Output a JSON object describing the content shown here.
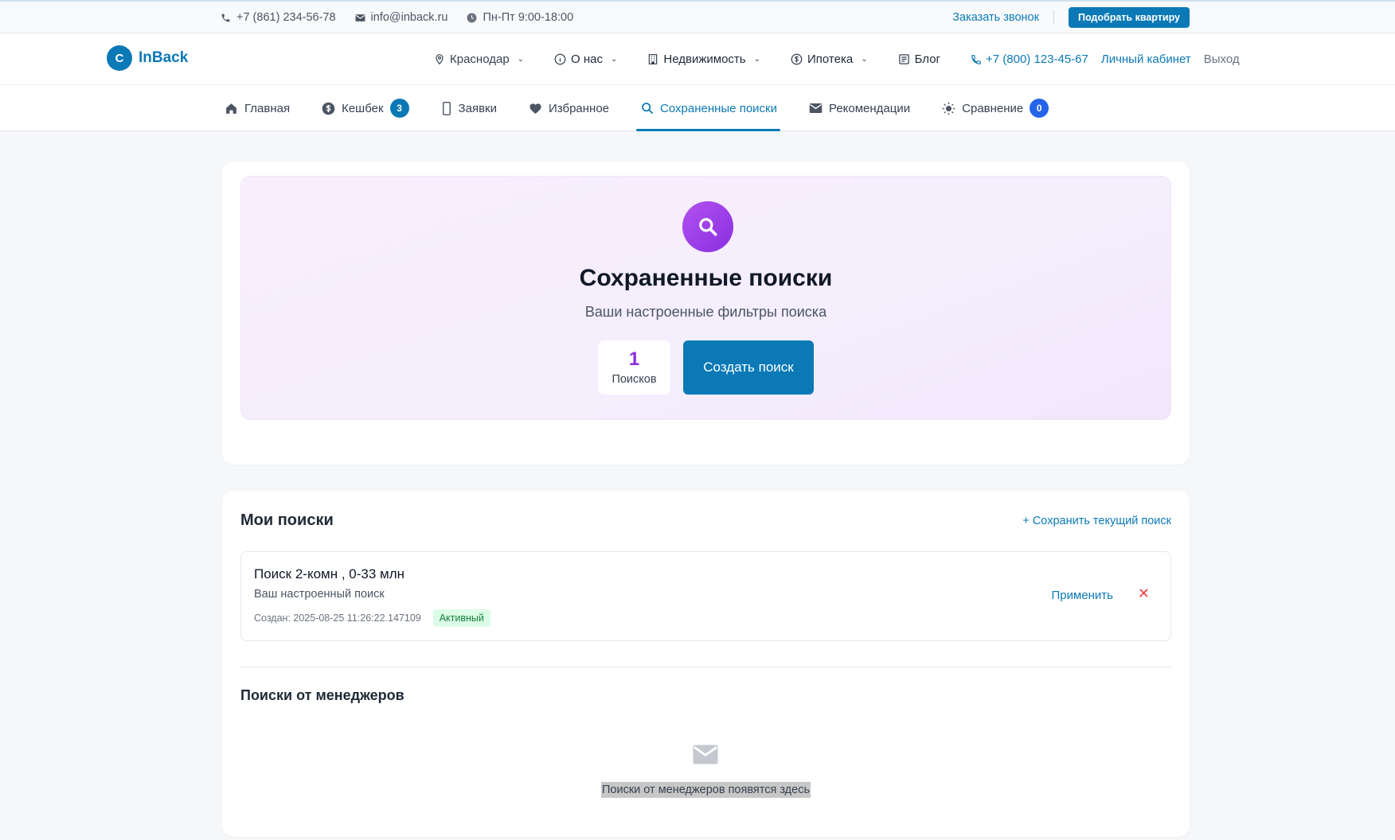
{
  "topbar": {
    "phone": "+7 (861) 234-56-78",
    "email": "info@inback.ru",
    "hours": "Пн-Пт 9:00-18:00",
    "callback": "Заказать звонок",
    "pick_apartment": "Подобрать квартиру"
  },
  "header": {
    "logo_letter": "C",
    "logo_name": "InBack",
    "city": "Краснодар",
    "nav": {
      "about": "О нас",
      "realty": "Недвижимость",
      "mortgage": "Ипотека",
      "blog": "Блог"
    },
    "phone": "+7 (800) 123-45-67",
    "cabinet": "Личный кабинет",
    "logout": "Выход"
  },
  "subnav": {
    "home": "Главная",
    "cashback": "Кешбек",
    "cashback_count": "3",
    "requests": "Заявки",
    "favorites": "Избранное",
    "saved_searches": "Сохраненные поиски",
    "recommendations": "Рекомендации",
    "comparison": "Сравнение",
    "comparison_count": "0"
  },
  "hero": {
    "title": "Сохраненные поиски",
    "subtitle": "Ваши настроенные фильтры поиска",
    "count": "1",
    "count_label": "Поисков",
    "create_button": "Создать поиск"
  },
  "my_searches": {
    "title": "Мои поиски",
    "save_current": "+ Сохранить текущий поиск",
    "items": [
      {
        "title": "Поиск 2-комн , 0-33 млн",
        "description": "Ваш настроенный поиск",
        "created": "Создан: 2025-08-25 11:26:22.147109",
        "status": "Активный",
        "apply": "Применить",
        "delete": "✕"
      }
    ]
  },
  "manager_searches": {
    "title": "Поиски от менеджеров",
    "empty": "Поиски от менеджеров появятся здесь"
  },
  "colors": {
    "brand": "#0b79b6",
    "accent_purple": "#8a2fe0",
    "badge_blue": "#2563eb",
    "status_green": "#15803d"
  },
  "icons": [
    "phone-icon",
    "mail-icon",
    "clock-icon",
    "pin-icon",
    "info-icon",
    "building-icon",
    "dollar-icon",
    "news-icon",
    "home-icon",
    "coin-icon",
    "phone-device-icon",
    "heart-icon",
    "search-icon",
    "envelope-icon",
    "sun-icon",
    "close-icon"
  ]
}
